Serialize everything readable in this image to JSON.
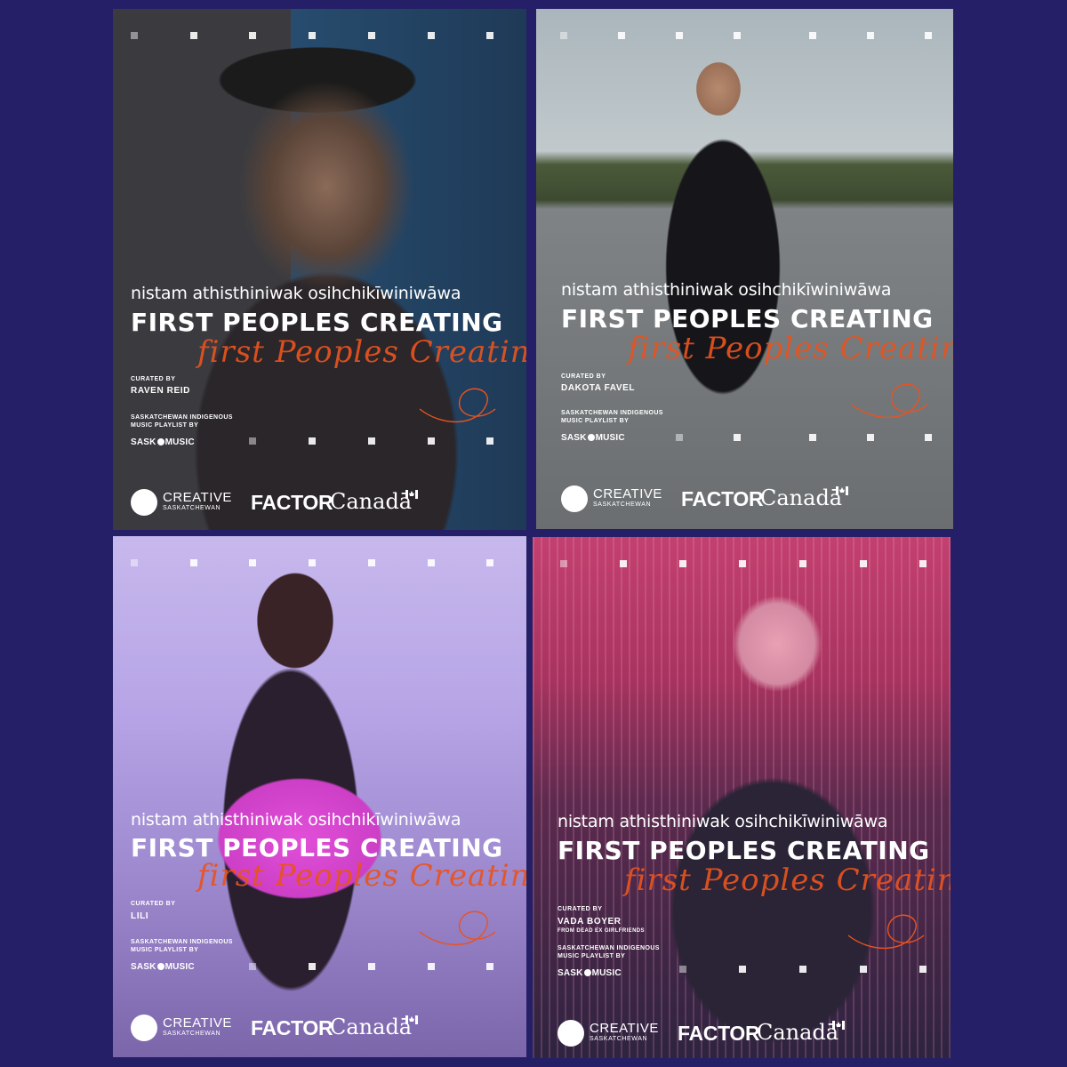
{
  "posters": [
    {
      "cree_title": "nistam athisthiniwak osihchikīwiniwāwa",
      "title": "FIRST PEOPLES CREATING",
      "script_title": "first Peoples Creating",
      "curated_by_label": "CURATED BY",
      "curator": "RAVEN REID",
      "curator_note": "",
      "playlist_label": "SASKATCHEWAN INDIGENOUS MUSIC PLAYLIST BY",
      "sask_left": "SASK",
      "sask_right": "MUSIC",
      "logos": {
        "creative": "CREATIVE",
        "saskatchewan": "SASKATCHEWAN",
        "factor": "FACTOR",
        "canada": "Canadā"
      },
      "colors": {
        "photo_top": "#2f4a63",
        "photo_bottom": "#2a2a30",
        "accent": "#e8531f"
      }
    },
    {
      "cree_title": "nistam athisthiniwak osihchikīwiniwāwa",
      "title": "FIRST PEOPLES CREATING",
      "script_title": "first Peoples Creating",
      "curated_by_label": "CURATED BY",
      "curator": "DAKOTA FAVEL",
      "curator_note": "",
      "playlist_label": "SASKATCHEWAN INDIGENOUS MUSIC PLAYLIST BY",
      "sask_left": "SASK",
      "sask_right": "MUSIC",
      "logos": {
        "creative": "CREATIVE",
        "saskatchewan": "SASKATCHEWAN",
        "factor": "FACTOR",
        "canada": "Canadā"
      },
      "colors": {
        "photo_top": "#9aa6ad",
        "photo_bottom": "#5b5e60",
        "accent": "#e8531f"
      }
    },
    {
      "cree_title": "nistam athisthiniwak osihchikīwiniwāwa",
      "title": "FIRST PEOPLES CREATING",
      "script_title": "first Peoples Creating",
      "curated_by_label": "CURATED BY",
      "curator": "LILI",
      "curator_note": "",
      "playlist_label": "SASKATCHEWAN INDIGENOUS MUSIC PLAYLIST BY",
      "sask_left": "SASK",
      "sask_right": "MUSIC",
      "logos": {
        "creative": "CREATIVE",
        "saskatchewan": "SASKATCHEWAN",
        "factor": "FACTOR",
        "canada": "Canadā"
      },
      "colors": {
        "photo_top": "#c8b6e8",
        "photo_bottom": "#6a4c8a",
        "accent": "#e8531f"
      }
    },
    {
      "cree_title": "nistam athisthiniwak osihchikīwiniwāwa",
      "title": "FIRST PEOPLES CREATING",
      "script_title": "first Peoples Creating",
      "curated_by_label": "CURATED BY",
      "curator": "VADA BOYER",
      "curator_note": "FROM DEAD EX GIRLFRIENDS",
      "playlist_label": "SASKATCHEWAN INDIGENOUS MUSIC PLAYLIST BY",
      "sask_left": "SASK",
      "sask_right": "MUSIC",
      "logos": {
        "creative": "CREATIVE",
        "saskatchewan": "SASKATCHEWAN",
        "factor": "FACTOR",
        "canada": "Canadā"
      },
      "colors": {
        "photo_top": "#c23a6e",
        "photo_bottom": "#2b2040",
        "accent": "#e8531f"
      }
    }
  ]
}
